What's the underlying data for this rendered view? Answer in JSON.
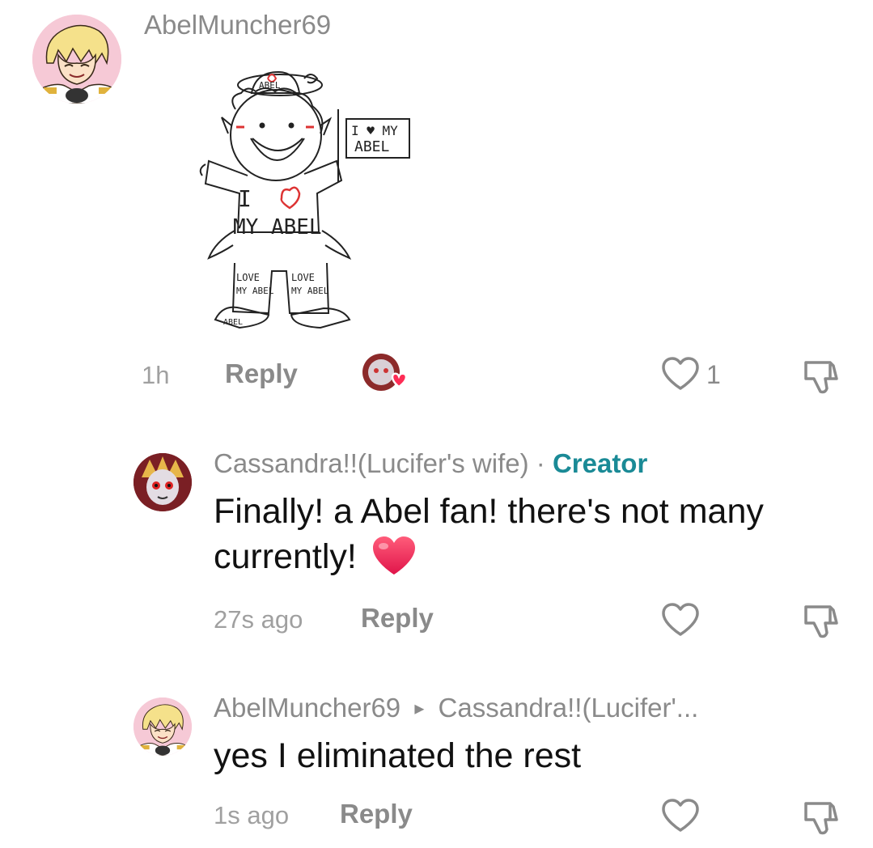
{
  "comment1": {
    "username": "AbelMuncher69",
    "time": "1h",
    "reply_label": "Reply",
    "like_count": "1",
    "avatar_icon": "anime-avatar-icon",
    "liked_by_icon": "creator-liked-avatar-icon",
    "sticker": {
      "icon": "abel-fan-drawing",
      "cap_text": "ABEL",
      "flag_text": [
        "I ♥ MY",
        "ABEL"
      ],
      "shirt_text": [
        "I",
        "MY ABEL"
      ],
      "pants_text": [
        "LOVE",
        "MY ABEL"
      ],
      "shoe_text": "ABEL"
    }
  },
  "comment2": {
    "username": "Cassandra!!(Lucifer's wife)",
    "separator": " · ",
    "badge": "Creator",
    "text": "Finally! a Abel fan! there's not many currently!",
    "emoji": "heart-emoji",
    "time": "27s ago",
    "reply_label": "Reply"
  },
  "comment3": {
    "username": "AbelMuncher69",
    "arrow": "▸",
    "reply_to": "Cassandra!!(Lucifer'...",
    "text": "yes I eliminated the rest",
    "time": "1s ago",
    "reply_label": "Reply"
  },
  "colors": {
    "accent": "#1a8a96",
    "heart_red": "#fe2c55",
    "muted": "#8a8a8a"
  }
}
